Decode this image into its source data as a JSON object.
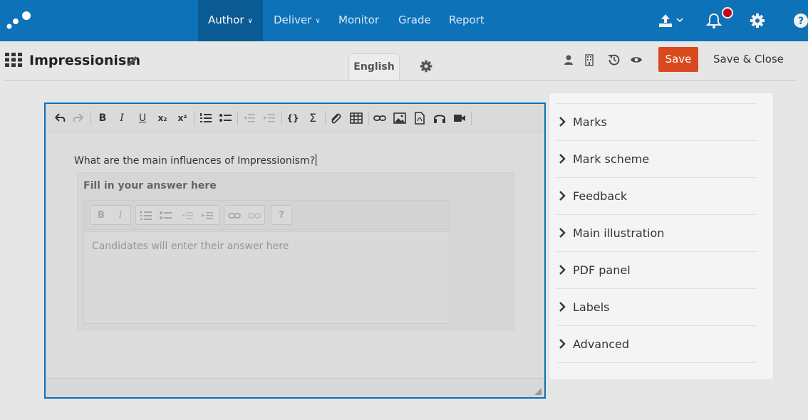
{
  "nav": {
    "items": [
      {
        "label": "Author",
        "caret": true,
        "active": true
      },
      {
        "label": "Deliver",
        "caret": true,
        "active": false
      },
      {
        "label": "Monitor",
        "caret": false,
        "active": false
      },
      {
        "label": "Grade",
        "caret": false,
        "active": false
      },
      {
        "label": "Report",
        "caret": false,
        "active": false
      }
    ],
    "icons": [
      "upload-icon",
      "bell-icon",
      "gear-icon",
      "help-icon"
    ],
    "color": "#0d72b8"
  },
  "header": {
    "title": "Impressionism",
    "language_tab": "English",
    "save_label": "Save",
    "save_close_label": "Save & Close",
    "save_color": "#d8491d"
  },
  "editor": {
    "question": "What are the main influences of Impressionism?",
    "answer_title": "Fill in your answer here",
    "answer_placeholder": "Candidates will enter their answer here",
    "toolbar_bold": "B",
    "toolbar_italic": "I",
    "toolbar_underline": "U",
    "toolbar_subscript": "x₂",
    "toolbar_superscript": "x²",
    "toolbar_code": "{}",
    "toolbar_sigma": "Σ",
    "ans_bold": "B",
    "ans_italic": "I",
    "ans_help": "?"
  },
  "panel": {
    "items": [
      "Marks",
      "Mark scheme",
      "Feedback",
      "Main illustration",
      "PDF panel",
      "Labels",
      "Advanced"
    ]
  }
}
